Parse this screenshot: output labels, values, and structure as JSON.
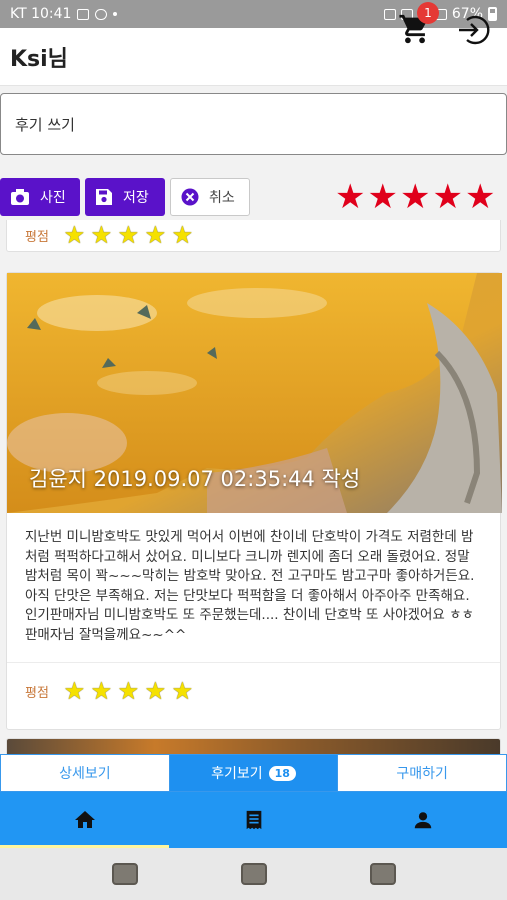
{
  "status_bar": {
    "carrier_time": "KT 10:41",
    "battery": "67%"
  },
  "header": {
    "title": "Ksi님",
    "cart_count": "1"
  },
  "review_form": {
    "placeholder": "후기 쓰기",
    "photo_label": "사진",
    "save_label": "저장",
    "cancel_label": "취소",
    "rating": 5
  },
  "reviews": [
    {
      "rating_label": "평점",
      "rating": 5
    },
    {
      "author_caption": "김윤지  2019.09.07 02:35:44 작성",
      "text": "지난번 미니밤호박도 맛있게 먹어서 이번에 찬이네 단호박이 가격도 저렴한데 밤처럼 퍽퍽하다고해서 샀어요. 미니보다 크니까 렌지에 좀더 오래 돌렸어요. 정말 밤처럼 목이 꽉~~~막히는 밤호박 맞아요. 전 고구마도 밤고구마 좋아하거든요. 아직 단맛은 부족해요. 저는 단맛보다 퍽퍽함을 더 좋아해서 아주아주 만족해요. 인기판매자님 미니밤호박도 또 주문했는데.... 찬이네 단호박 또 사야겠어요 ㅎㅎ 판매자님 잘먹을께요~~^^",
      "rating_label": "평점",
      "rating": 5
    }
  ],
  "tabs": [
    {
      "label": "상세보기",
      "active": false
    },
    {
      "label": "후기보기",
      "count": "18",
      "active": true
    },
    {
      "label": "구매하기",
      "active": false
    }
  ],
  "colors": {
    "primary_button": "#5a12c9",
    "star_red": "#e0001b",
    "star_yellow": "#f5e100",
    "tab_blue": "#1e90f0",
    "nav_blue": "#2196f3"
  }
}
